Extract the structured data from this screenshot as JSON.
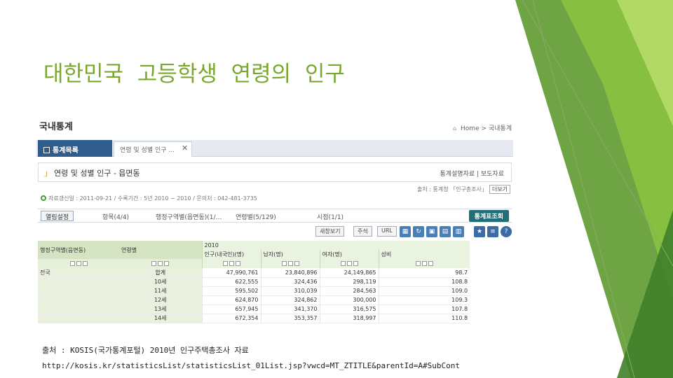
{
  "slide": {
    "title": "대한민국  고등학생  연령의  인구",
    "source_label": "출처 : KOSIS(국가통계포털) 2010년 인구주택총조사 자료",
    "source_url": "http://kosis.kr/statisticsList/statisticsList_01List.jsp?vwcd=MT_ZTITLE&parentId=A#SubCont"
  },
  "colors": {
    "accent_green": "#7aa82e",
    "tab_blue": "#2f5c8a",
    "search_teal": "#1f6e79"
  },
  "kosis": {
    "page_title": "국내통계",
    "breadcrumb": "Home > 국내통계",
    "tab_list_label": "통계목록",
    "tab_current_label": "연령 및 성별 인구 ...",
    "tab_close": "✕",
    "table_name": "연령 및 성별 인구 - 읍면동",
    "table_links": "통계설명자료 | 보도자료",
    "source_line": "출처 : 통계청 「인구총조사」",
    "more_label": "더보기",
    "info_line": "자료갱신일 : 2011-09-21 / 수록기간 : 5년 2010 ~ 2010 / 문의처 : 042-481-3735",
    "filters": {
      "layout_button": "열림설정",
      "item": "항목(4/4)",
      "region": "행정구역별(읍면동)(1/…",
      "age": "연령별(5/129)",
      "time": "시점(1/1)",
      "search_button": "통계표조회"
    },
    "tools": {
      "view_option": "새창보기",
      "note": "주석",
      "url": "URL"
    },
    "grid": {
      "col_region": "행정구역별(읍면동)",
      "col_age": "연령별",
      "year": "2010",
      "col_total": "인구(내국인)(명)",
      "col_male": "남자(명)",
      "col_female": "여자(명)",
      "col_ratio": "성비",
      "region_value": "전국",
      "rows": [
        {
          "age": "합계",
          "total": "47,990,761",
          "male": "23,840,896",
          "female": "24,149,865",
          "ratio": "98.7"
        },
        {
          "age": "10세",
          "total": "622,555",
          "male": "324,436",
          "female": "298,119",
          "ratio": "108.8"
        },
        {
          "age": "11세",
          "total": "595,502",
          "male": "310,039",
          "female": "284,563",
          "ratio": "109.0"
        },
        {
          "age": "12세",
          "total": "624,870",
          "male": "324,862",
          "female": "300,000",
          "ratio": "109.3"
        },
        {
          "age": "13세",
          "total": "657,945",
          "male": "341,370",
          "female": "316,575",
          "ratio": "107.8"
        },
        {
          "age": "14세",
          "total": "672,354",
          "male": "353,357",
          "female": "318,997",
          "ratio": "110.8"
        }
      ]
    }
  }
}
